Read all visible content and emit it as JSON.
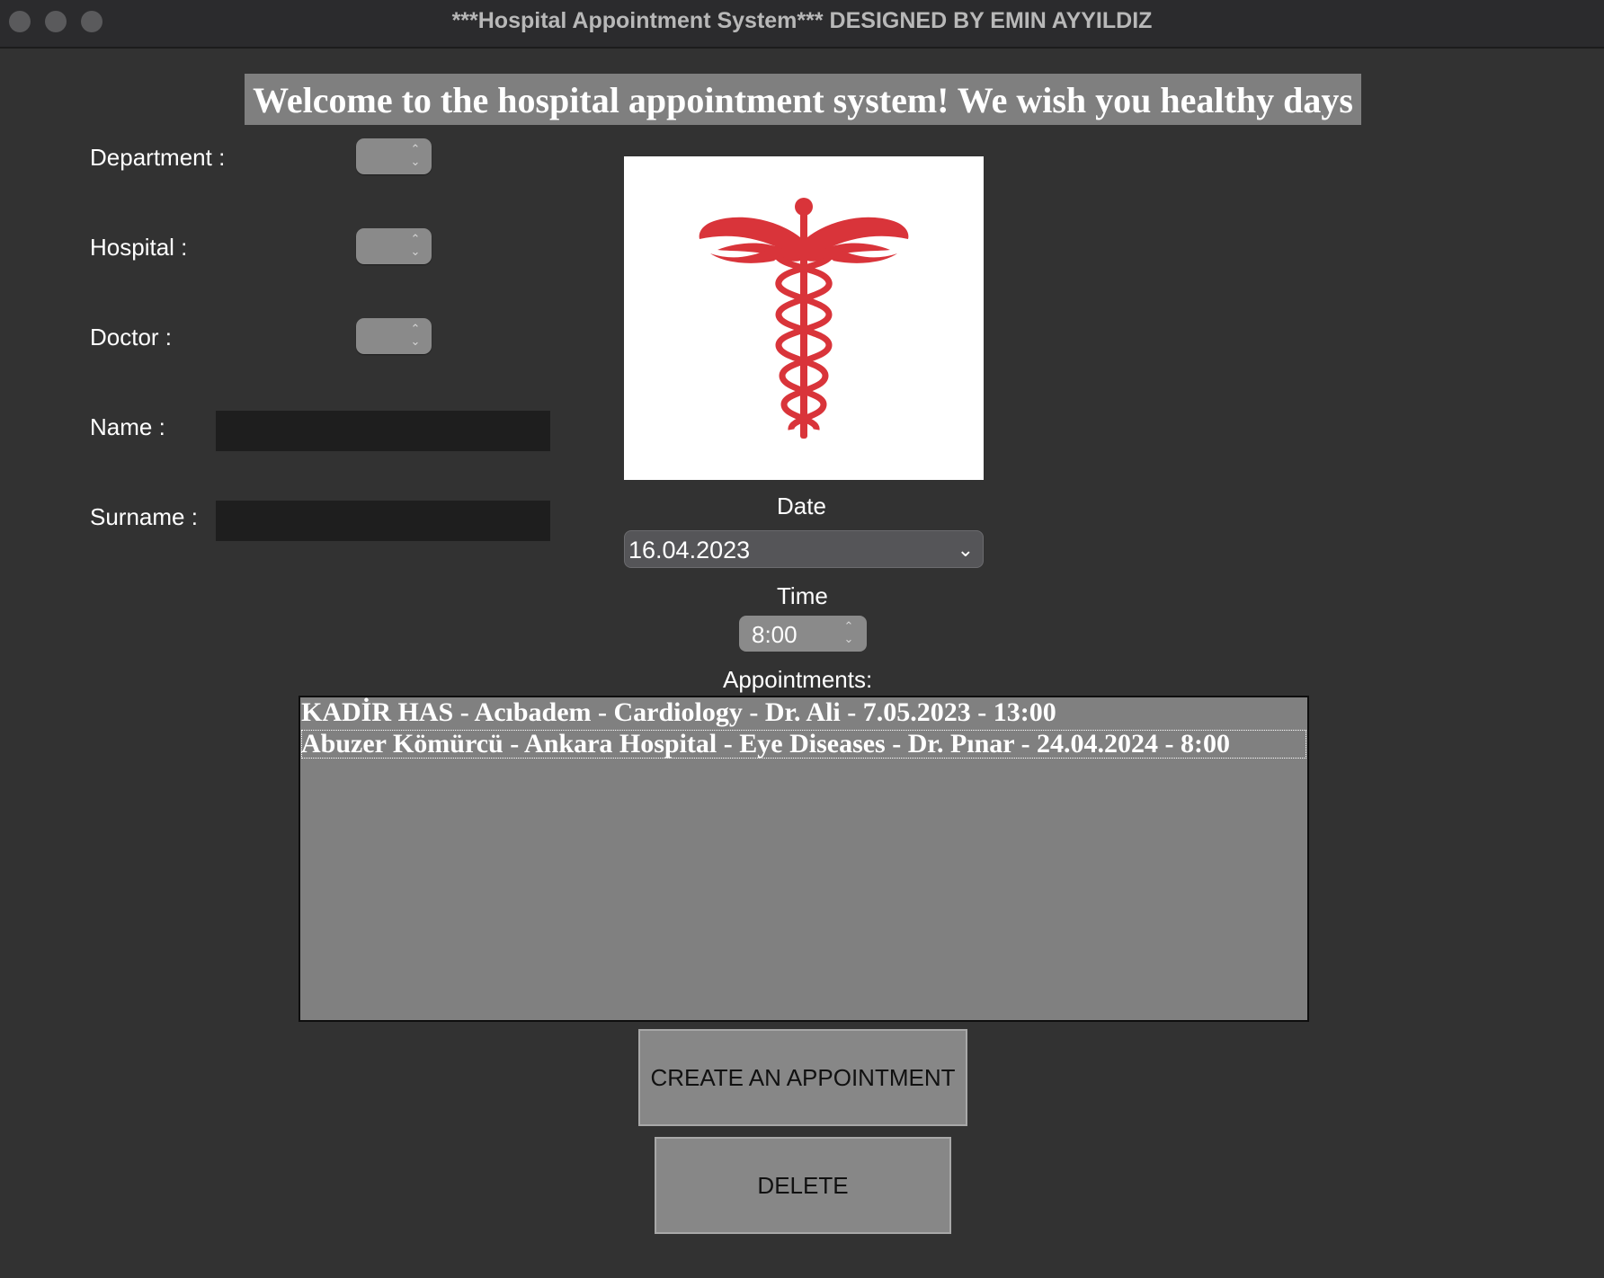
{
  "window": {
    "title": "***Hospital Appointment System*** DESIGNED BY EMIN AYYILDIZ"
  },
  "header": {
    "welcome": "Welcome to the hospital appointment system! We wish you healthy days"
  },
  "form": {
    "department_label": "Department :",
    "hospital_label": "Hospital :",
    "doctor_label": "Doctor :",
    "name_label": "Name :",
    "surname_label": "Surname :",
    "name_value": "",
    "surname_value": ""
  },
  "logo": {
    "icon": "caduceus-icon",
    "color": "#d9343a"
  },
  "date": {
    "label": "Date",
    "value": "16.04.2023"
  },
  "time": {
    "label": "Time",
    "value": "8:00"
  },
  "appointments": {
    "label": "Appointments:",
    "items": [
      "KADİR HAS - Acıbadem - Cardiology - Dr. Ali - 7.05.2023 - 13:00",
      "Abuzer Kömürcü - Ankara Hospital - Eye Diseases - Dr. Pınar - 24.04.2024 - 8:00"
    ]
  },
  "buttons": {
    "create": "CREATE AN APPOINTMENT",
    "delete": "DELETE"
  }
}
